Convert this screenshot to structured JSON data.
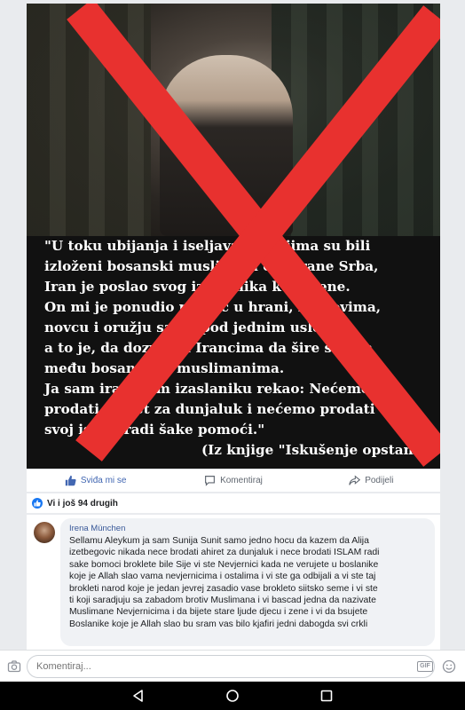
{
  "post": {
    "quote_lines": [
      "\"U toku ubijanja i iseljavanja kojima su bili",
      "izloženi bosanski muslimani od strane Srba,",
      "Iran je poslao svog izaslanika kod mene.",
      "On mi je ponudio pomoć u hrani, lijekovima,",
      "novcu i oružju samo pod jednim uslovom,",
      "a to je, da dozvolim Irancima da šire šiizam",
      "među bosanskim muslimanima.",
      "Ja sam iranskom izaslaniku rekao: Nećemo",
      "prodati ahiret za dunjaluk i nećemo prodati",
      "svoj islam radi šake pomoći.\""
    ],
    "source": "(Iz knjige \"Iskušenje opstanka",
    "cross_color": "#e8312f"
  },
  "actions": {
    "like": "Sviđa mi se",
    "comment": "Komentiraj",
    "share": "Podijeli"
  },
  "reactions": {
    "text": "Vi i još 94 drugih"
  },
  "comment": {
    "author": "Irena München",
    "lines": [
      "Sellamu Aleykum ja sam Sunija Sunit  samo jedno hocu da kazem da Alija",
      "izetbegovic nikada nece brodati ahiret za dunjaluk i nece brodati ISLAM radi",
      "sake bomoci broklete bile Sije vi ste Nevjernici kada ne verujete u boslanike",
      "koje je Allah slao vama nevjernicima i ostalima i vi ste ga odbijali a vi ste taj",
      "brokleti narod koje je jedan jevrej zasadio vase brokleto siitsko seme i vi ste",
      "ti koji saradjuju sa zabadom brotiv Muslimana i vi bascad jedna da nazivate",
      "Muslimane Nevjernicima i da bijete stare ljude djecu i zene i vi da bsujete",
      "Boslanike koje je Allah slao bu sram vas bilo kjafiri jedni dabogda svi crkli"
    ]
  },
  "composer": {
    "placeholder": "Komentiraj...",
    "gif_label": "GIF"
  },
  "colors": {
    "accent": "#4267b2",
    "like_badge": "#1877f2"
  }
}
